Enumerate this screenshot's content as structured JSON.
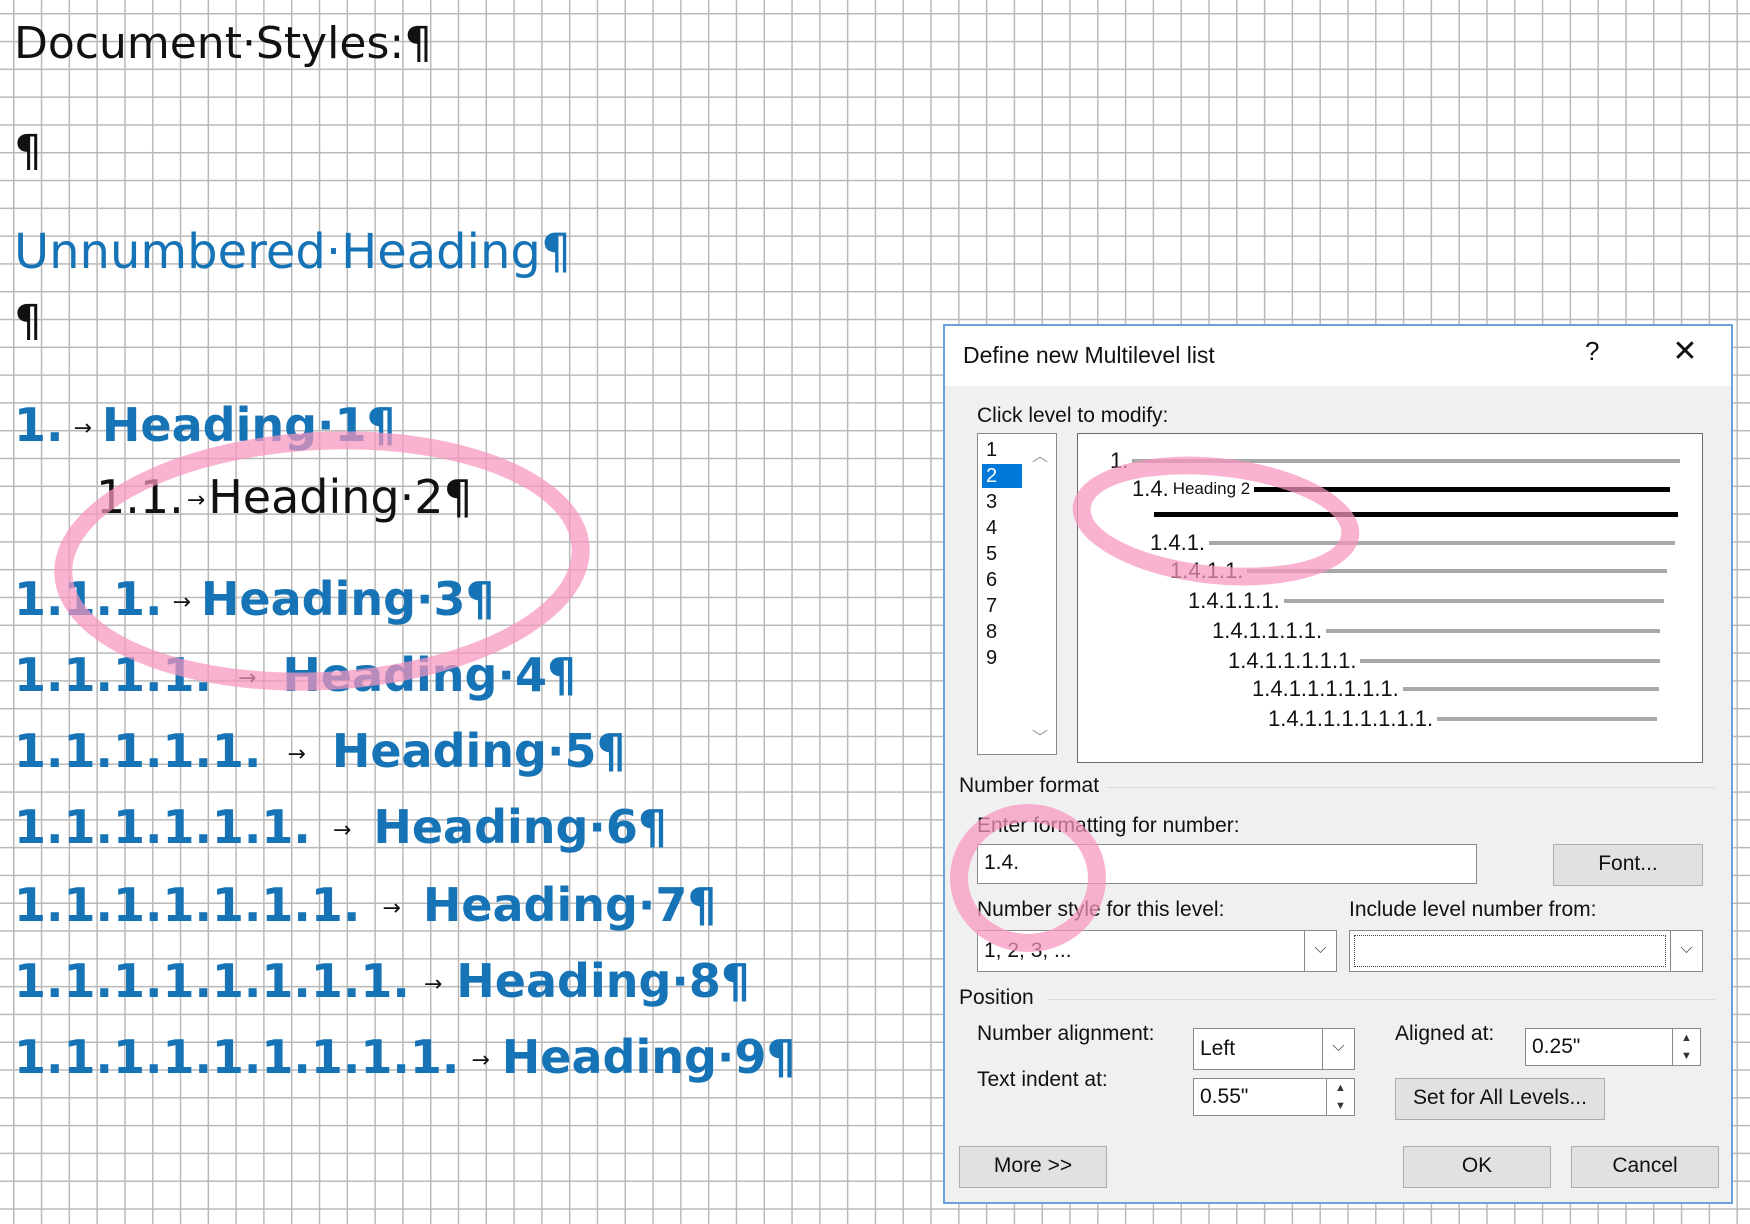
{
  "document": {
    "title_line": "Document·Styles:¶",
    "empty_para_1": "¶",
    "unnumbered_heading": "Unnumbered·Heading¶",
    "empty_para_2": "¶",
    "arrow_glyph": "→",
    "headings": [
      {
        "num": "1.",
        "text": "Heading·1¶"
      },
      {
        "num": "1.1.",
        "text": "Heading·2¶"
      },
      {
        "num": "1.1.1.",
        "text": "Heading·3¶"
      },
      {
        "num": "1.1.1.1.",
        "text": "Heading·4¶"
      },
      {
        "num": "1.1.1.1.1.",
        "text": "Heading·5¶"
      },
      {
        "num": "1.1.1.1.1.1.",
        "text": "Heading·6¶"
      },
      {
        "num": "1.1.1.1.1.1.1.",
        "text": "Heading·7¶"
      },
      {
        "num": "1.1.1.1.1.1.1.1.",
        "text": "Heading·8¶"
      },
      {
        "num": "1.1.1.1.1.1.1.1.1.",
        "text": "Heading·9¶"
      }
    ]
  },
  "dialog": {
    "title": "Define new Multilevel list",
    "help_label": "?",
    "close_label": "✕",
    "click_level_label": "Click level to modify:",
    "levels": [
      "1",
      "2",
      "3",
      "4",
      "5",
      "6",
      "7",
      "8",
      "9"
    ],
    "selected_level": "2",
    "scroll_up": "︿",
    "scroll_down": "﹀",
    "preview": {
      "lines": [
        "1.",
        "1.4.",
        "1.4.1.",
        "1.4.1.1.",
        "1.4.1.1.1.",
        "1.4.1.1.1.1.",
        "1.4.1.1.1.1.1.",
        "1.4.1.1.1.1.1.1.",
        "1.4.1.1.1.1.1.1.1."
      ],
      "heading2_label": "Heading 2"
    },
    "number_format_group": "Number format",
    "enter_formatting_label": "Enter formatting for number:",
    "formatting_value": "1.4.",
    "font_button": "Font...",
    "number_style_label": "Number style for this level:",
    "number_style_value": "1, 2, 3, ...",
    "include_level_label": "Include level number from:",
    "include_level_value": "",
    "position_group": "Position",
    "number_alignment_label": "Number alignment:",
    "number_alignment_value": "Left",
    "aligned_at_label": "Aligned at:",
    "aligned_at_value": "0.25\"",
    "text_indent_label": "Text indent at:",
    "text_indent_value": "0.55\"",
    "set_all_levels_button": "Set for All Levels...",
    "more_button": "More >>",
    "ok_button": "OK",
    "cancel_button": "Cancel",
    "dropdown_glyph": "⌵",
    "spin_up": "▲",
    "spin_down": "▼"
  }
}
